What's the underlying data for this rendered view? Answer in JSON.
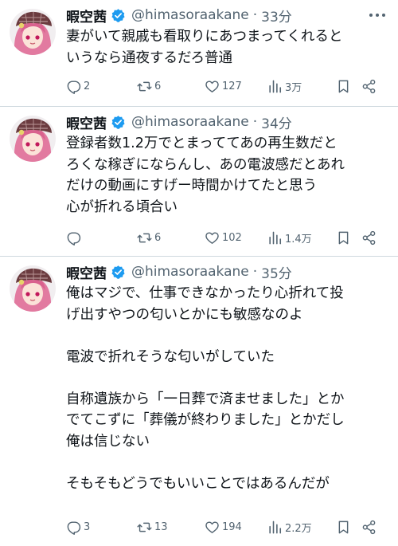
{
  "icons": [
    "more-icon",
    "verified-icon",
    "reply-icon",
    "retweet-icon",
    "like-icon",
    "views-icon",
    "bookmark-icon",
    "share-icon"
  ],
  "colors": {
    "text": "#0f1419",
    "secondary": "#536471",
    "verified": "#1d9bf0",
    "divider": "#cfd9de"
  },
  "tweets": [
    {
      "name": "暇空茜",
      "handle": "@himasoraakane",
      "separator": "·",
      "time": "33分",
      "lines": [
        "妻がいて親戚も看取りにあつまってくれると",
        "いうなら通夜するだろ普通"
      ],
      "reply_count": "2",
      "retweet_count": "6",
      "like_count": "127",
      "view_count": "3万"
    },
    {
      "name": "暇空茜",
      "handle": "@himasoraakane",
      "separator": "·",
      "time": "34分",
      "lines": [
        "登録者数1.2万でとまっててあの再生数だと",
        "ろくな稼ぎにならんし、あの電波感だとあれ",
        "だけの動画にすげー時間かけてたと思う",
        "心が折れる頃合い"
      ],
      "reply_count": "",
      "retweet_count": "6",
      "like_count": "102",
      "view_count": "1.4万"
    },
    {
      "name": "暇空茜",
      "handle": "@himasoraakane",
      "separator": "·",
      "time": "35分",
      "lines": [
        "俺はマジで、仕事できなかったり心折れて投",
        "げ出すやつの匂いとかにも敏感なのよ",
        "",
        "電波で折れそうな匂いがしていた",
        "",
        "自称遺族から「一日葬で済ませました」とか",
        "でてこずに「葬儀が終わりました」とかだし",
        "俺は信じない",
        "",
        "そもそもどうでもいいことではあるんだが"
      ],
      "reply_count": "3",
      "retweet_count": "13",
      "like_count": "194",
      "view_count": "2.2万"
    }
  ]
}
